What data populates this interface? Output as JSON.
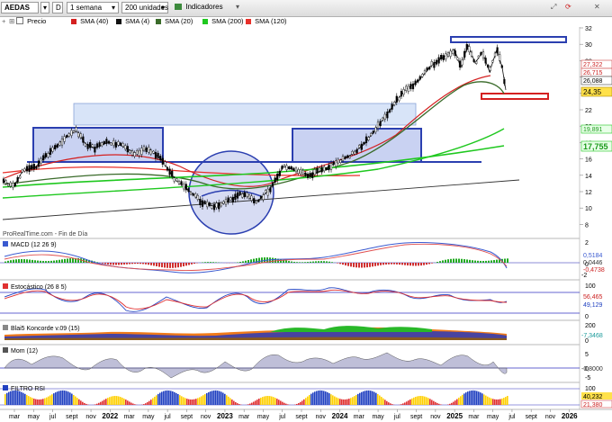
{
  "toolbar": {
    "ticker": "AEDAS",
    "d_button": "D",
    "timeframe": "1 semana",
    "units": "200 unidades",
    "indicators": "Indicadores"
  },
  "legend": {
    "price": "Precio",
    "sma1": "SMA (40)",
    "sma2": "SMA (4)",
    "sma3": "SMA (20)",
    "sma4": "SMA (200)",
    "sma5": "SMA (120)"
  },
  "colors": {
    "sma40": "#d42020",
    "sma4": "#111111",
    "sma20": "#3a6b2a",
    "sma200": "#1fc81f",
    "sma120": "#e8302a",
    "band": "#2b3fb0"
  },
  "price_axis": {
    "ticks": [
      "32",
      "30",
      "28",
      "26",
      "24",
      "22",
      "20",
      "18",
      "16",
      "14",
      "12",
      "10",
      "8"
    ],
    "labels": [
      "27,322",
      "26,715",
      "26,088",
      "24,35",
      "19,891",
      "17,755"
    ]
  },
  "watermark": "ProRealTime.com - Fin de Día",
  "panels": {
    "macd": {
      "title": "MACD (12 26 9)",
      "ticks": [
        "2",
        "0",
        "-2"
      ],
      "values": [
        "0,5184",
        "0,0446",
        "-0,4738"
      ]
    },
    "stoch": {
      "title": "Estocástico (26 8 5)",
      "ticks": [
        "100",
        "0"
      ],
      "values": [
        "56,465",
        "49,129"
      ]
    },
    "koncorde": {
      "title": "Blai5 Koncorde v.09 (15)",
      "ticks": [
        "200",
        "0"
      ],
      "values": [
        "-7,3468"
      ]
    },
    "mom": {
      "title": "Mom (12)",
      "ticks": [
        "5",
        "0",
        "-5"
      ],
      "values": [
        "-0,8000"
      ]
    },
    "filtro": {
      "title": "FILTRO RSI",
      "ticks": [
        "100",
        "0"
      ],
      "values": [
        "40,232",
        "21,380"
      ]
    }
  },
  "x_axis": [
    "mar",
    "may",
    "jul",
    "sept",
    "nov",
    "2022",
    "mar",
    "may",
    "jul",
    "sept",
    "nov",
    "2023",
    "mar",
    "may",
    "jul",
    "sept",
    "nov",
    "2024",
    "mar",
    "may",
    "jul",
    "sept",
    "nov",
    "2025",
    "mar",
    "may",
    "jul",
    "sept",
    "nov",
    "2026"
  ]
}
